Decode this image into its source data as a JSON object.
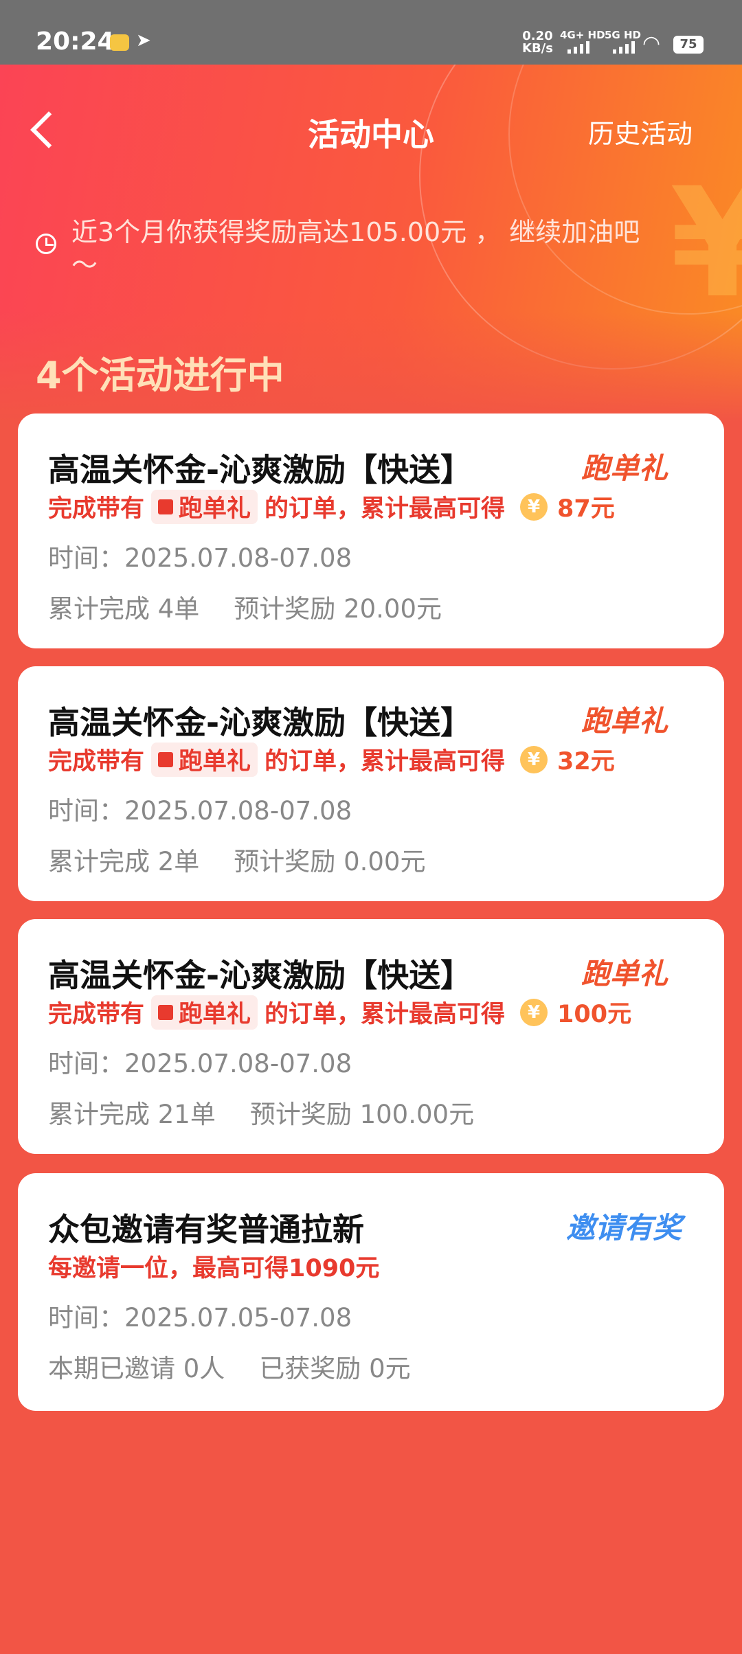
{
  "status_bar": {
    "time": "20:24",
    "net_speed": "0.20",
    "net_unit": "KB/s",
    "sim1": "4G+ HD",
    "sim2": "5G HD",
    "battery": "75"
  },
  "header": {
    "title": "活动中心",
    "history_link": "历史活动"
  },
  "reward_summary": "近3个月你获得奖励高达105.00元 ， 继续加油吧～",
  "active_count": "4个活动进行中",
  "activities": [
    {
      "title": "高温关怀金-沁爽激励【快送】",
      "tag": "跑单礼",
      "desc_prefix": "完成带有",
      "pill": "跑单礼",
      "desc_suffix": "的订单，累计最高可得",
      "coin": "¥",
      "amount": "87元",
      "time": "时间：2025.07.08-07.08",
      "stat1": "累计完成 4单",
      "stat2": "预计奖励 20.00元"
    },
    {
      "title": "高温关怀金-沁爽激励【快送】",
      "tag": "跑单礼",
      "desc_prefix": "完成带有",
      "pill": "跑单礼",
      "desc_suffix": "的订单，累计最高可得",
      "coin": "¥",
      "amount": "32元",
      "time": "时间：2025.07.08-07.08",
      "stat1": "累计完成 2单",
      "stat2": "预计奖励 0.00元"
    },
    {
      "title": "高温关怀金-沁爽激励【快送】",
      "tag": "跑单礼",
      "desc_prefix": "完成带有",
      "pill": "跑单礼",
      "desc_suffix": "的订单，累计最高可得",
      "coin": "¥",
      "amount": "100元",
      "time": "时间：2025.07.08-07.08",
      "stat1": "累计完成 21单",
      "stat2": "预计奖励 100.00元"
    },
    {
      "title": "众包邀请有奖普通拉新",
      "tag": "邀请有奖",
      "desc": "每邀请一位，最高可得1090元",
      "time": "时间：2025.07.05-07.08",
      "stat1": "本期已邀请 0人",
      "stat2": "已获奖励 0元"
    }
  ]
}
